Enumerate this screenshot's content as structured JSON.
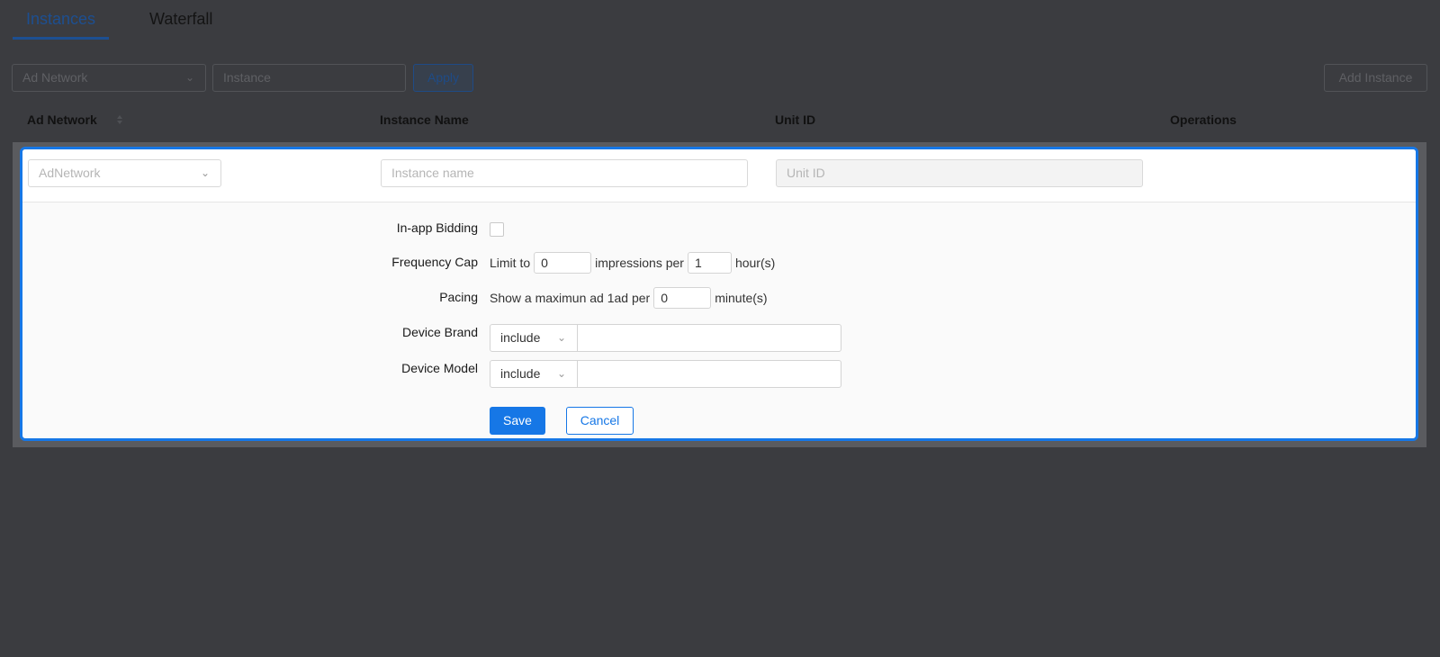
{
  "tabs": [
    {
      "label": "Instances",
      "active": true
    },
    {
      "label": "Waterfall",
      "active": false
    }
  ],
  "filter": {
    "ad_network_placeholder": "Ad Network",
    "instance_placeholder": "Instance",
    "apply_label": "Apply",
    "add_instance_label": "Add Instance"
  },
  "table": {
    "columns": [
      "Ad Network",
      "Instance Name",
      "Unit ID",
      "Operations"
    ]
  },
  "edit_row": {
    "ad_network_placeholder": "AdNetwork",
    "instance_name_placeholder": "Instance name",
    "unit_id_placeholder": "Unit ID",
    "in_app_bidding": {
      "label": "In-app Bidding",
      "checked": false
    },
    "frequency_cap": {
      "label": "Frequency Cap",
      "prefix": "Limit to",
      "impressions": "0",
      "middle": "impressions per",
      "hours": "1",
      "suffix": "hour(s)"
    },
    "pacing": {
      "label": "Pacing",
      "prefix": "Show a maximun ad 1ad per",
      "minutes": "0",
      "suffix": "minute(s)"
    },
    "device_brand": {
      "label": "Device Brand",
      "mode": "include",
      "value": ""
    },
    "device_model": {
      "label": "Device Model",
      "mode": "include",
      "value": ""
    },
    "save_label": "Save",
    "cancel_label": "Cancel"
  },
  "colors": {
    "overlay_bg": "#3b3c40",
    "accent": "#1677e6",
    "active_tab": "#1d4f91"
  }
}
